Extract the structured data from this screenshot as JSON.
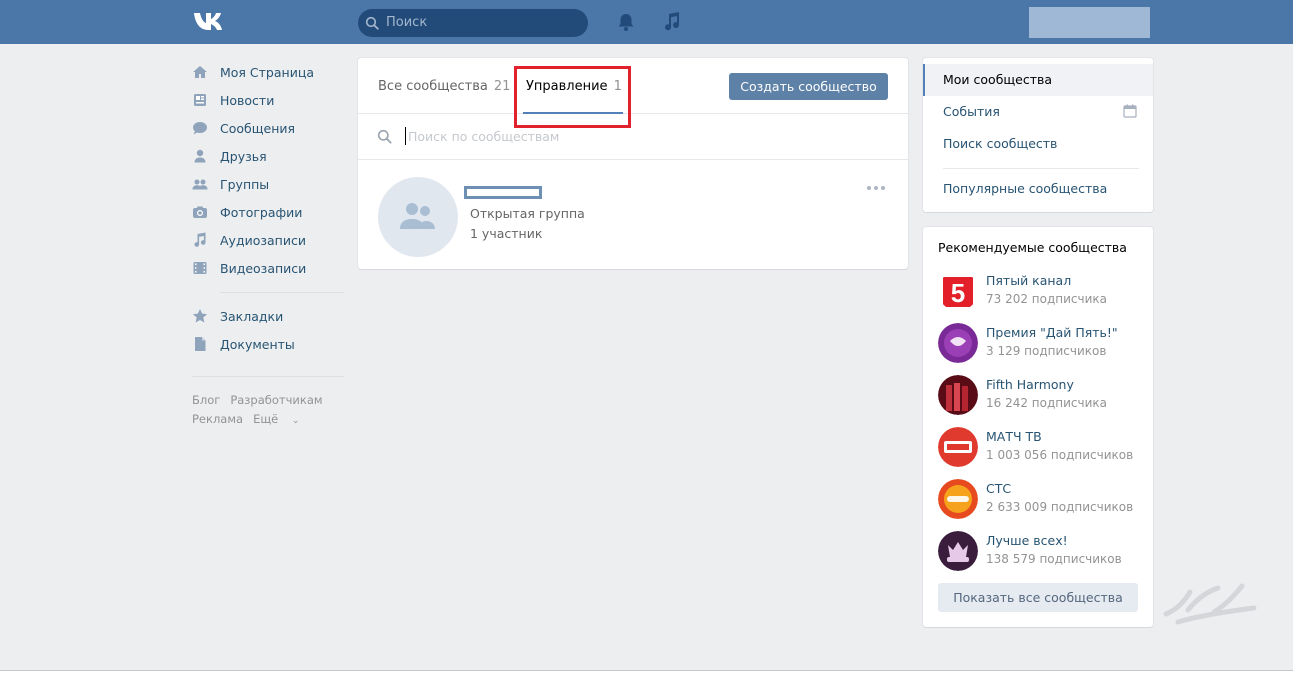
{
  "header": {
    "search_placeholder": "Поиск",
    "colors": {
      "bar": "#4a76a8"
    }
  },
  "left_nav": {
    "items": [
      {
        "label": "Моя Страница",
        "icon": "home-icon"
      },
      {
        "label": "Новости",
        "icon": "news-icon"
      },
      {
        "label": "Сообщения",
        "icon": "messages-icon"
      },
      {
        "label": "Друзья",
        "icon": "friends-icon"
      },
      {
        "label": "Группы",
        "icon": "groups-icon"
      },
      {
        "label": "Фотографии",
        "icon": "photos-icon"
      },
      {
        "label": "Аудиозаписи",
        "icon": "audio-icon"
      },
      {
        "label": "Видеозаписи",
        "icon": "video-icon"
      }
    ],
    "items2": [
      {
        "label": "Закладки",
        "icon": "star-icon"
      },
      {
        "label": "Документы",
        "icon": "document-icon"
      }
    ],
    "footer": {
      "blog": "Блог",
      "developers": "Разработчикам",
      "ads": "Реклама",
      "more": "Ещё"
    }
  },
  "main": {
    "tabs": [
      {
        "label": "Все сообщества",
        "count": "21"
      },
      {
        "label": "Управление",
        "count": "1"
      }
    ],
    "create_button": "Создать сообщество",
    "search_placeholder": "Поиск по сообществам",
    "group": {
      "type": "Открытая группа",
      "members": "1 участник"
    }
  },
  "right_menu": {
    "items": [
      {
        "label": "Мои сообщества"
      },
      {
        "label": "События"
      },
      {
        "label": "Поиск сообществ"
      },
      {
        "label": "Популярные сообщества"
      }
    ]
  },
  "recommended": {
    "title": "Рекомендуемые сообщества",
    "items": [
      {
        "name": "Пятый канал",
        "subs": "73 202 подписчика",
        "color": "#e3202a"
      },
      {
        "name": "Премия \"Дай Пять!\"",
        "subs": "3 129 подписчиков",
        "color": "#7a2a96"
      },
      {
        "name": "Fifth Harmony",
        "subs": "16 242 подписчика",
        "color": "#8c1020"
      },
      {
        "name": "МАТЧ ТВ",
        "subs": "1 003 056 подписчиков",
        "color": "#e03a2f"
      },
      {
        "name": "СТС",
        "subs": "2 633 009 подписчиков",
        "color": "#f6a21c"
      },
      {
        "name": "Лучше всех!",
        "subs": "138 579 подписчиков",
        "color": "#3a1d3d"
      }
    ],
    "show_all": "Показать все сообщества"
  }
}
